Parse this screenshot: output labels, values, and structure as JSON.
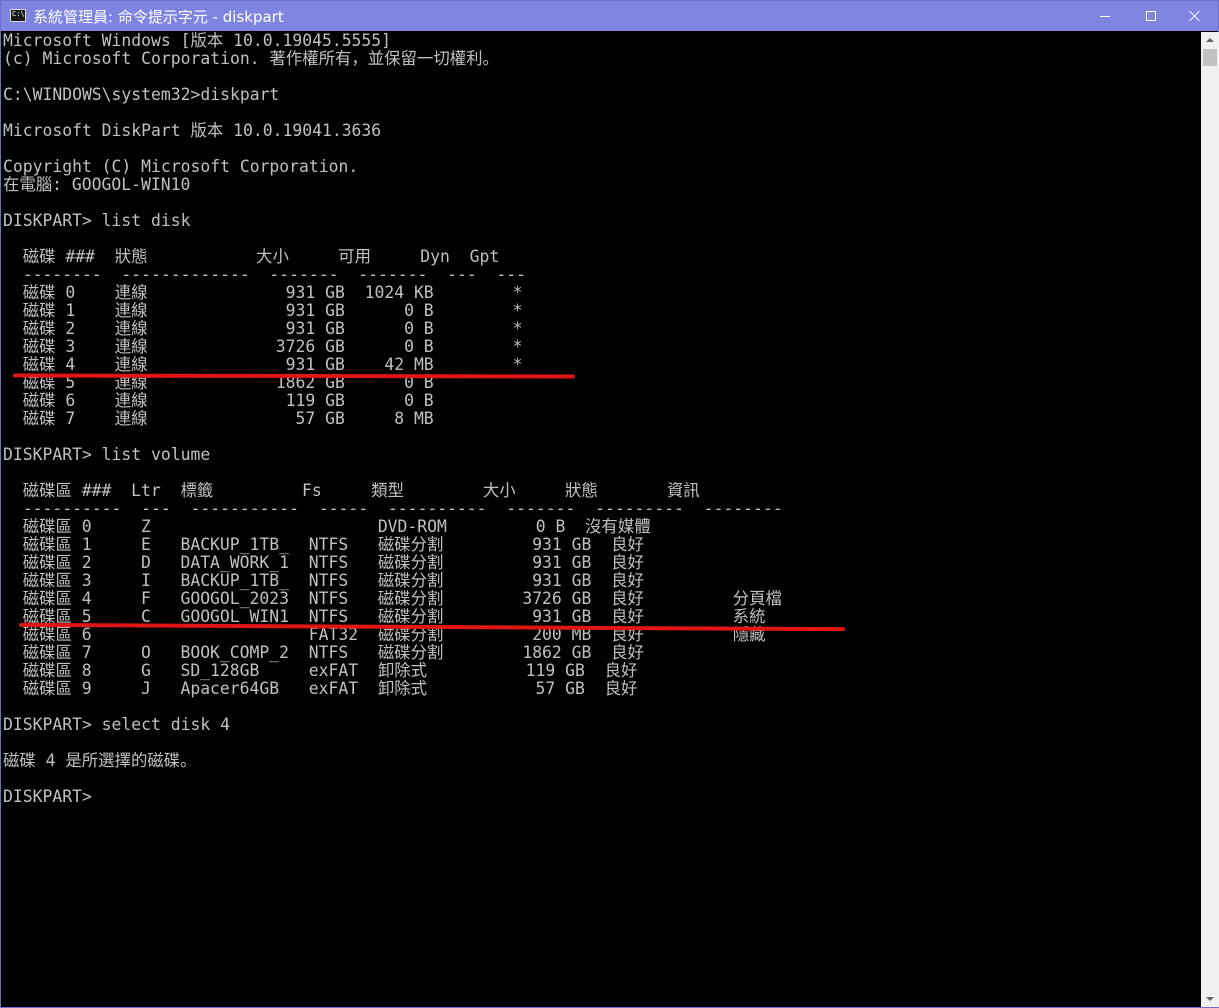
{
  "window": {
    "title": "系統管理員: 命令提示字元 - diskpart",
    "controls": {
      "minimize": "minimize",
      "maximize": "maximize",
      "close": "close"
    }
  },
  "console": {
    "lines": [
      "Microsoft Windows [版本 10.0.19045.5555]",
      "(c) Microsoft Corporation. 著作權所有，並保留一切權利。",
      "",
      "C:\\WINDOWS\\system32>diskpart",
      "",
      "Microsoft DiskPart 版本 10.0.19041.3636",
      "",
      "Copyright (C) Microsoft Corporation.",
      "在電腦: GOOGOL-WIN10",
      "",
      "DISKPART> list disk",
      "",
      "  磁碟 ###  狀態           大小     可用     Dyn  Gpt",
      "  --------  -------------  -------  -------  ---  ---",
      "  磁碟 0    連線              931 GB  1024 KB        *",
      "  磁碟 1    連線              931 GB      0 B        *",
      "  磁碟 2    連線              931 GB      0 B        *",
      "  磁碟 3    連線             3726 GB      0 B        *",
      "  磁碟 4    連線              931 GB    42 MB        *",
      "  磁碟 5    連線             1862 GB      0 B",
      "  磁碟 6    連線              119 GB      0 B",
      "  磁碟 7    連線               57 GB     8 MB",
      "",
      "DISKPART> list volume",
      "",
      "  磁碟區 ###  Ltr  標籤         Fs     類型        大小     狀態       資訊",
      "  ----------  ---  -----------  -----  ----------  -------  ---------  --------",
      "  磁碟區 0     Z                       DVD-ROM         0 B  沒有媒體",
      "  磁碟區 1     E   BACKUP_1TB_  NTFS   磁碟分割         931 GB  良好",
      "  磁碟區 2     D   DATA_WORK_1  NTFS   磁碟分割         931 GB  良好",
      "  磁碟區 3     I   BACKUP_1TB_  NTFS   磁碟分割         931 GB  良好",
      "  磁碟區 4     F   GOOGOL_2023  NTFS   磁碟分割        3726 GB  良好         分頁檔",
      "  磁碟區 5     C   GOOGOL_WIN1  NTFS   磁碟分割         931 GB  良好         系統",
      "  磁碟區 6                      FAT32  磁碟分割         200 MB  良好         隱藏",
      "  磁碟區 7     O   BOOK_COMP_2  NTFS   磁碟分割        1862 GB  良好",
      "  磁碟區 8     G   SD_128GB     exFAT  卸除式          119 GB  良好",
      "  磁碟區 9     J   Apacer64GB   exFAT  卸除式           57 GB  良好",
      "",
      "DISKPART> select disk 4",
      "",
      "磁碟 4 是所選擇的磁碟。",
      "",
      "DISKPART>"
    ]
  },
  "colors": {
    "titlebar": "#7f84e0",
    "console_background": "#000000",
    "console_text": "#c0c0c0",
    "annotation": "#e01515"
  }
}
